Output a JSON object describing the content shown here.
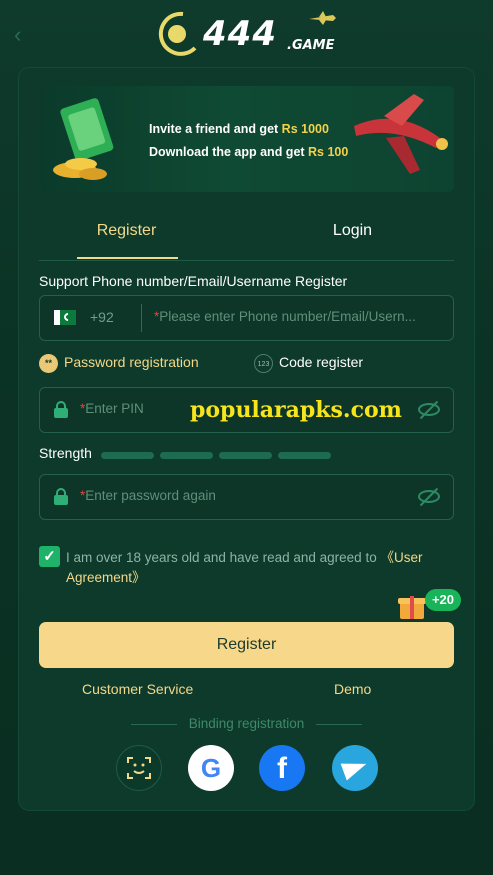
{
  "header": {
    "back_icon": "chevron-left-icon",
    "logo_number": "444",
    "logo_suffix": ".GAME"
  },
  "banner": {
    "line1_prefix": "Invite a friend and get ",
    "line1_amount": "Rs 1000",
    "line2_prefix": "Download the app and get ",
    "line2_amount": "Rs 100"
  },
  "tabs": [
    {
      "label": "Register",
      "active": true
    },
    {
      "label": "Login",
      "active": false
    }
  ],
  "form": {
    "section_label": "Support Phone number/Email/Username Register",
    "country_code": "+92",
    "phone_placeholder": "Please enter Phone number/Email/Usern...",
    "modes": {
      "password_label": "Password registration",
      "password_icon_text": "**",
      "code_label": "Code register",
      "code_icon_text": "123"
    },
    "pin_placeholder": "Enter PIN",
    "watermark": "popularapks.com",
    "strength_label": "Strength",
    "password_again_placeholder": "Enter password again",
    "agreement_text": "I am over 18 years old and have read and agreed to ",
    "agreement_link": "《User Agreement》",
    "agreement_checked": true,
    "bonus_badge": "+20",
    "register_button": "Register"
  },
  "footer": {
    "customer_service": "Customer Service",
    "demo": "Demo",
    "binding_label": "Binding registration",
    "social": [
      "face-id-icon",
      "google-icon",
      "facebook-icon",
      "telegram-icon"
    ]
  },
  "colors": {
    "accent": "#f3d88a",
    "background": "#0b3325",
    "card": "#0e3a2b",
    "check": "#1fb36a"
  }
}
